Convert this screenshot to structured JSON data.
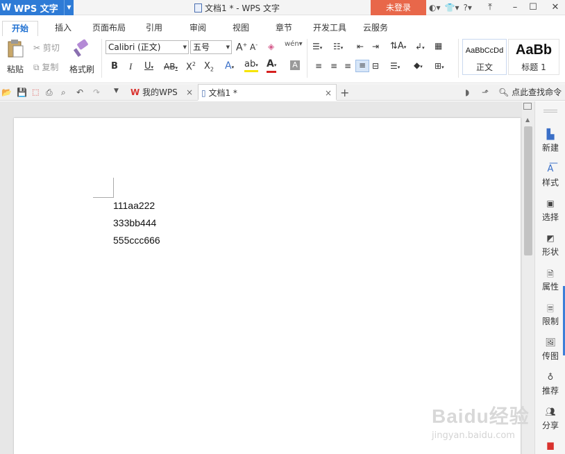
{
  "app": {
    "name": "WPS 文字",
    "window_title": "文档1 * - WPS 文字",
    "login_label": "未登录"
  },
  "menu_tabs": [
    "开始",
    "插入",
    "页面布局",
    "引用",
    "审阅",
    "视图",
    "章节",
    "开发工具",
    "云服务"
  ],
  "ribbon": {
    "paste": "粘贴",
    "cut": "剪切",
    "copy": "复制",
    "format_painter": "格式刷",
    "font_name": "Calibri (正文)",
    "font_size": "五号",
    "styles": [
      {
        "preview": "AaBbCcDd",
        "name": "正文"
      },
      {
        "preview": "AaBb",
        "name": "标题 1"
      }
    ]
  },
  "tabs": [
    {
      "label": "我的WPS"
    },
    {
      "label": "文档1 *"
    }
  ],
  "command_search": "点此查找命令",
  "document": {
    "lines": [
      "111aa222",
      "333bb444",
      "555ccc666"
    ]
  },
  "right_pane": [
    "新建",
    "样式",
    "选择",
    "形状",
    "属性",
    "限制",
    "传图",
    "推荐",
    "分享"
  ],
  "watermark": {
    "brand": "Baidu经验",
    "url": "jingyan.baidu.com"
  },
  "colors": {
    "accent": "#2e7bd6",
    "login": "#e8674a",
    "wps_red": "#d9322e"
  }
}
